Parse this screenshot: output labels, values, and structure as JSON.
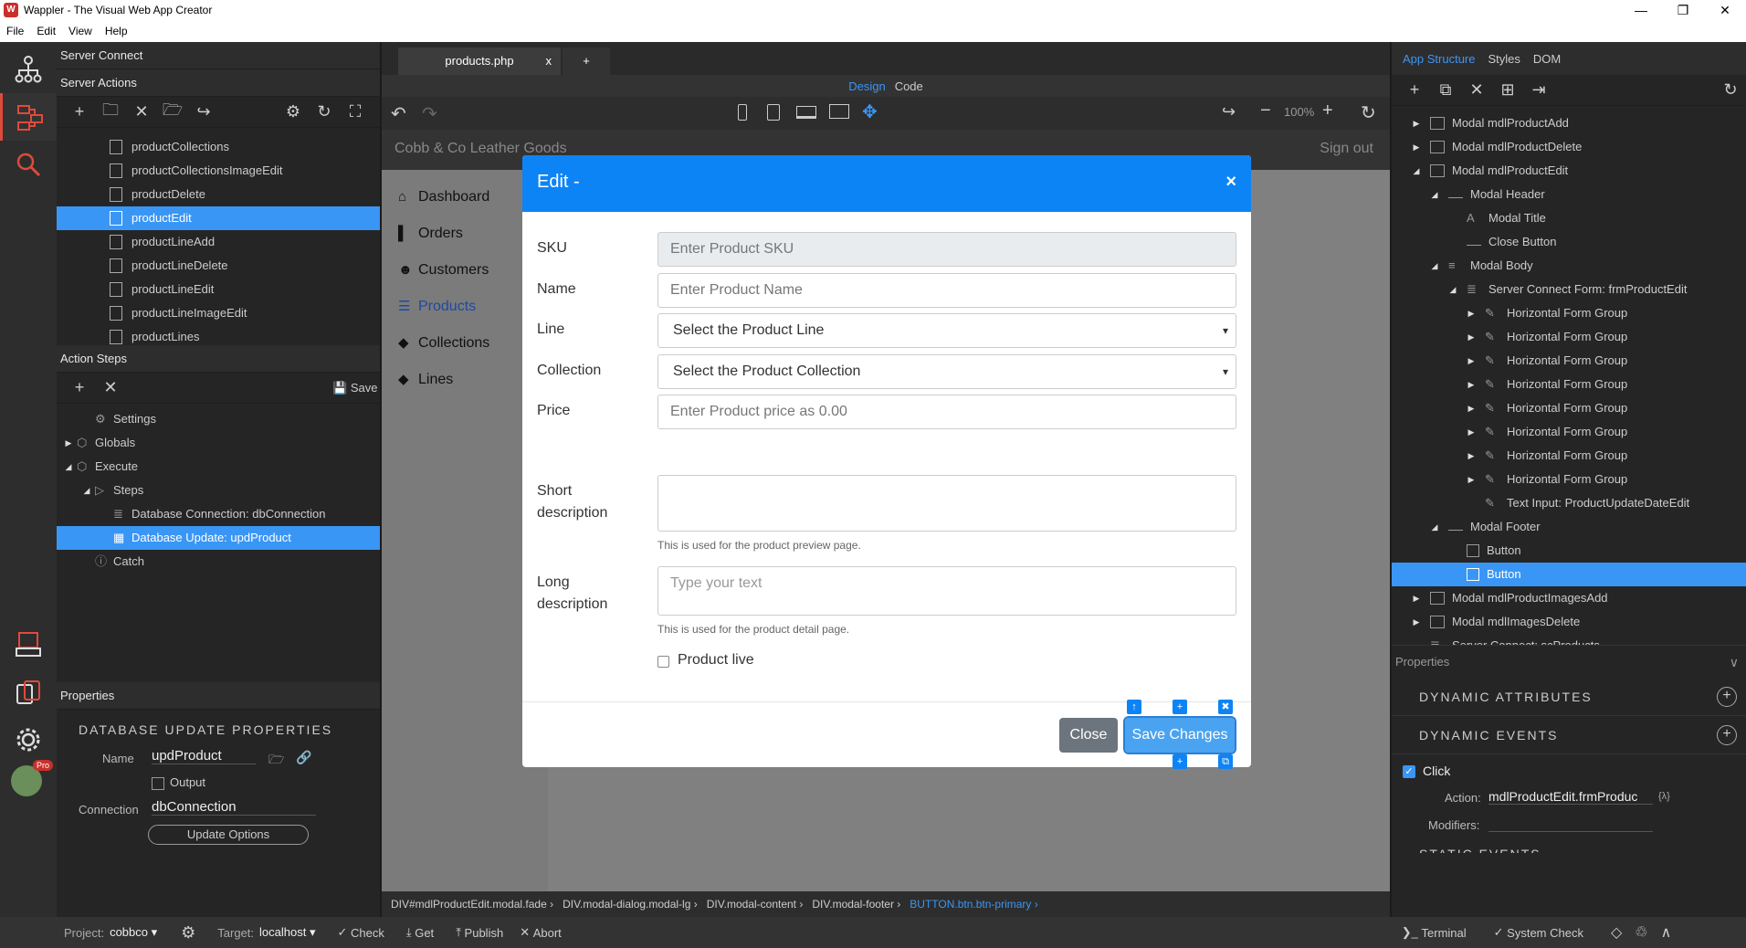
{
  "window": {
    "title": "Wappler - The Visual Web App Creator",
    "logo": "W",
    "controls": [
      "—",
      "❐",
      "✕"
    ]
  },
  "menu": [
    "File",
    "Edit",
    "View",
    "Help"
  ],
  "activity": {
    "icons": [
      "sitemap-icon",
      "server-connect-icon",
      "search-icon",
      "app-connect-icon",
      "resource-icon",
      "settings-icon",
      "avatar"
    ],
    "badge": "Pro"
  },
  "left": {
    "header": "Server Connect",
    "actions_header": "Server Actions",
    "files": [
      "productCollections",
      "productCollectionsImageEdit",
      "productDelete",
      "productEdit",
      "productLineAdd",
      "productLineDelete",
      "productLineEdit",
      "productLineImageEdit",
      "productLines"
    ],
    "selected_file": "productEdit",
    "steps_header": "Action Steps",
    "save_label": "Save",
    "steps": [
      {
        "label": "Settings",
        "indent": 1,
        "arrow": "",
        "icon": "gear"
      },
      {
        "label": "Globals",
        "indent": 0,
        "arrow": "▶",
        "icon": "cube"
      },
      {
        "label": "Execute",
        "indent": 0,
        "arrow": "◢",
        "icon": "cube"
      },
      {
        "label": "Steps",
        "indent": 1,
        "arrow": "◢",
        "icon": "play"
      },
      {
        "label": "Database Connection: dbConnection",
        "indent": 2,
        "arrow": "",
        "icon": "db"
      },
      {
        "label": "Database Update: updProduct",
        "indent": 2,
        "arrow": "",
        "icon": "table",
        "selected": true
      },
      {
        "label": "Catch",
        "indent": 1,
        "arrow": "",
        "icon": "info"
      }
    ],
    "props_header": "Properties",
    "props_title": "DATABASE UPDATE PROPERTIES",
    "name_label": "Name",
    "name_value": "updProduct",
    "output_label": "Output",
    "conn_label": "Connection",
    "conn_value": "dbConnection",
    "update_options": "Update Options"
  },
  "center": {
    "tab": "products.php",
    "tab_close": "x",
    "new_tab": "+",
    "mode_design": "Design",
    "mode_code": "Code",
    "zoom": "100%",
    "app": {
      "brand": "Cobb & Co Leather Goods",
      "signout": "Sign out",
      "nav": [
        {
          "icon": "⌂",
          "label": "Dashboard"
        },
        {
          "icon": "▌",
          "label": "Orders"
        },
        {
          "icon": "☻",
          "label": "Customers"
        },
        {
          "icon": "☰",
          "label": "Products",
          "active": true
        },
        {
          "icon": "◆",
          "label": "Collections"
        },
        {
          "icon": "◆",
          "label": "Lines"
        }
      ]
    },
    "modal": {
      "title": "Edit -",
      "close": "×",
      "fields": [
        {
          "label": "SKU",
          "placeholder": "Enter Product SKU",
          "type": "disabled"
        },
        {
          "label": "Name",
          "placeholder": "Enter Product Name",
          "type": "text"
        },
        {
          "label": "Line",
          "placeholder": "Select the Product Line",
          "type": "select"
        },
        {
          "label": "Collection",
          "placeholder": "Select the Product Collection",
          "type": "select"
        },
        {
          "label": "Price",
          "placeholder": "Enter Product price as 0.00",
          "type": "text"
        }
      ],
      "short_label": "Short description",
      "short_help": "This is used for the product preview page.",
      "long_label": "Long description",
      "long_placeholder": "Type your text",
      "long_help": "This is used for the product detail page.",
      "live_label": "Product live",
      "close_btn": "Close",
      "save_btn": "Save Changes"
    },
    "crumbs": [
      "DIV#mdlProductEdit.modal.fade ›",
      "DIV.modal-dialog.modal-lg ›",
      "DIV.modal-content ›",
      "DIV.modal-footer ›",
      "BUTTON.btn.btn-primary ›"
    ]
  },
  "right": {
    "tabs": [
      "App Structure",
      "Styles",
      "DOM"
    ],
    "tree": [
      {
        "label": "Modal mdlProductAdd",
        "lvl": 0,
        "arrow": "▶",
        "icon": "box"
      },
      {
        "label": "Modal mdlProductDelete",
        "lvl": 0,
        "arrow": "▶",
        "icon": "box"
      },
      {
        "label": "Modal mdlProductEdit",
        "lvl": 0,
        "arrow": "◢",
        "icon": "box"
      },
      {
        "label": "Modal Header",
        "lvl": 1,
        "arrow": "◢",
        "icon": "line"
      },
      {
        "label": "Modal Title",
        "lvl": 2,
        "arrow": "",
        "icon": "A"
      },
      {
        "label": "Close Button",
        "lvl": 2,
        "arrow": "",
        "icon": "line"
      },
      {
        "label": "Modal Body",
        "lvl": 1,
        "arrow": "◢",
        "icon": "lines"
      },
      {
        "label": "Server Connect Form: frmProductEdit",
        "lvl": 2,
        "arrow": "◢",
        "icon": "db"
      },
      {
        "label": "Horizontal Form Group",
        "lvl": 3,
        "arrow": "▶",
        "icon": "pen"
      },
      {
        "label": "Horizontal Form Group",
        "lvl": 3,
        "arrow": "▶",
        "icon": "pen"
      },
      {
        "label": "Horizontal Form Group",
        "lvl": 3,
        "arrow": "▶",
        "icon": "pen"
      },
      {
        "label": "Horizontal Form Group",
        "lvl": 3,
        "arrow": "▶",
        "icon": "pen"
      },
      {
        "label": "Horizontal Form Group",
        "lvl": 3,
        "arrow": "▶",
        "icon": "pen"
      },
      {
        "label": "Horizontal Form Group",
        "lvl": 3,
        "arrow": "▶",
        "icon": "pen"
      },
      {
        "label": "Horizontal Form Group",
        "lvl": 3,
        "arrow": "▶",
        "icon": "pen"
      },
      {
        "label": "Horizontal Form Group",
        "lvl": 3,
        "arrow": "▶",
        "icon": "pen"
      },
      {
        "label": "Text Input: ProductUpdateDateEdit",
        "lvl": 3,
        "arrow": "",
        "icon": "pen"
      },
      {
        "label": "Modal Footer",
        "lvl": 1,
        "arrow": "◢",
        "icon": "line"
      },
      {
        "label": "Button",
        "lvl": 2,
        "arrow": "",
        "icon": "sq"
      },
      {
        "label": "Button",
        "lvl": 2,
        "arrow": "",
        "icon": "sq",
        "selected": true
      },
      {
        "label": "Modal mdlProductImagesAdd",
        "lvl": 0,
        "arrow": "▶",
        "icon": "box"
      },
      {
        "label": "Modal mdlImagesDelete",
        "lvl": 0,
        "arrow": "▶",
        "icon": "box"
      },
      {
        "label": "Server Connect: scProducts",
        "lvl": 0,
        "arrow": "",
        "icon": "db"
      }
    ],
    "props_header": "Properties",
    "dyn_attr": "DYNAMIC ATTRIBUTES",
    "dyn_events": "DYNAMIC EVENTS",
    "click_label": "Click",
    "action_label": "Action:",
    "action_value": "mdlProductEdit.frmProduc",
    "action_icon": "{λ}",
    "modifiers_label": "Modifiers:",
    "static_events": "STATIC EVENTS"
  },
  "status": {
    "project_label": "Project:",
    "project_value": "cobbco ▾",
    "target_label": "Target:",
    "target_value": "localhost ▾",
    "check": "Check",
    "get": "Get",
    "publish": "Publish",
    "abort": "Abort",
    "terminal": "Terminal",
    "system_check": "System Check"
  },
  "colors": {
    "accent": "#3a96f5",
    "modal_header": "#0d84f5",
    "close_btn": "#6c757d",
    "save_btn": "#4aa3f0"
  }
}
